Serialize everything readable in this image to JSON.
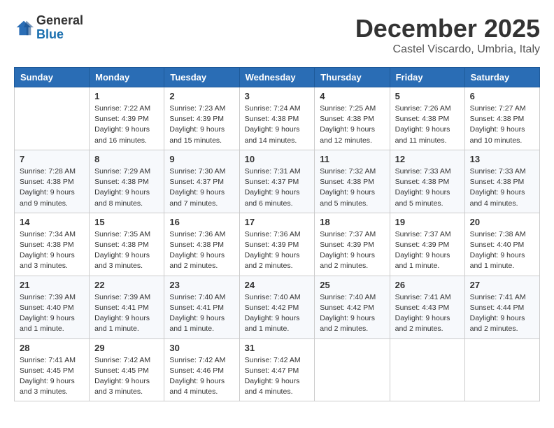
{
  "logo": {
    "general": "General",
    "blue": "Blue"
  },
  "header": {
    "month": "December 2025",
    "location": "Castel Viscardo, Umbria, Italy"
  },
  "weekdays": [
    "Sunday",
    "Monday",
    "Tuesday",
    "Wednesday",
    "Thursday",
    "Friday",
    "Saturday"
  ],
  "weeks": [
    [
      {
        "day": "",
        "text": ""
      },
      {
        "day": "1",
        "text": "Sunrise: 7:22 AM\nSunset: 4:39 PM\nDaylight: 9 hours\nand 16 minutes."
      },
      {
        "day": "2",
        "text": "Sunrise: 7:23 AM\nSunset: 4:39 PM\nDaylight: 9 hours\nand 15 minutes."
      },
      {
        "day": "3",
        "text": "Sunrise: 7:24 AM\nSunset: 4:38 PM\nDaylight: 9 hours\nand 14 minutes."
      },
      {
        "day": "4",
        "text": "Sunrise: 7:25 AM\nSunset: 4:38 PM\nDaylight: 9 hours\nand 12 minutes."
      },
      {
        "day": "5",
        "text": "Sunrise: 7:26 AM\nSunset: 4:38 PM\nDaylight: 9 hours\nand 11 minutes."
      },
      {
        "day": "6",
        "text": "Sunrise: 7:27 AM\nSunset: 4:38 PM\nDaylight: 9 hours\nand 10 minutes."
      }
    ],
    [
      {
        "day": "7",
        "text": "Sunrise: 7:28 AM\nSunset: 4:38 PM\nDaylight: 9 hours\nand 9 minutes."
      },
      {
        "day": "8",
        "text": "Sunrise: 7:29 AM\nSunset: 4:38 PM\nDaylight: 9 hours\nand 8 minutes."
      },
      {
        "day": "9",
        "text": "Sunrise: 7:30 AM\nSunset: 4:37 PM\nDaylight: 9 hours\nand 7 minutes."
      },
      {
        "day": "10",
        "text": "Sunrise: 7:31 AM\nSunset: 4:37 PM\nDaylight: 9 hours\nand 6 minutes."
      },
      {
        "day": "11",
        "text": "Sunrise: 7:32 AM\nSunset: 4:38 PM\nDaylight: 9 hours\nand 5 minutes."
      },
      {
        "day": "12",
        "text": "Sunrise: 7:33 AM\nSunset: 4:38 PM\nDaylight: 9 hours\nand 5 minutes."
      },
      {
        "day": "13",
        "text": "Sunrise: 7:33 AM\nSunset: 4:38 PM\nDaylight: 9 hours\nand 4 minutes."
      }
    ],
    [
      {
        "day": "14",
        "text": "Sunrise: 7:34 AM\nSunset: 4:38 PM\nDaylight: 9 hours\nand 3 minutes."
      },
      {
        "day": "15",
        "text": "Sunrise: 7:35 AM\nSunset: 4:38 PM\nDaylight: 9 hours\nand 3 minutes."
      },
      {
        "day": "16",
        "text": "Sunrise: 7:36 AM\nSunset: 4:38 PM\nDaylight: 9 hours\nand 2 minutes."
      },
      {
        "day": "17",
        "text": "Sunrise: 7:36 AM\nSunset: 4:39 PM\nDaylight: 9 hours\nand 2 minutes."
      },
      {
        "day": "18",
        "text": "Sunrise: 7:37 AM\nSunset: 4:39 PM\nDaylight: 9 hours\nand 2 minutes."
      },
      {
        "day": "19",
        "text": "Sunrise: 7:37 AM\nSunset: 4:39 PM\nDaylight: 9 hours\nand 1 minute."
      },
      {
        "day": "20",
        "text": "Sunrise: 7:38 AM\nSunset: 4:40 PM\nDaylight: 9 hours\nand 1 minute."
      }
    ],
    [
      {
        "day": "21",
        "text": "Sunrise: 7:39 AM\nSunset: 4:40 PM\nDaylight: 9 hours\nand 1 minute."
      },
      {
        "day": "22",
        "text": "Sunrise: 7:39 AM\nSunset: 4:41 PM\nDaylight: 9 hours\nand 1 minute."
      },
      {
        "day": "23",
        "text": "Sunrise: 7:40 AM\nSunset: 4:41 PM\nDaylight: 9 hours\nand 1 minute."
      },
      {
        "day": "24",
        "text": "Sunrise: 7:40 AM\nSunset: 4:42 PM\nDaylight: 9 hours\nand 1 minute."
      },
      {
        "day": "25",
        "text": "Sunrise: 7:40 AM\nSunset: 4:42 PM\nDaylight: 9 hours\nand 2 minutes."
      },
      {
        "day": "26",
        "text": "Sunrise: 7:41 AM\nSunset: 4:43 PM\nDaylight: 9 hours\nand 2 minutes."
      },
      {
        "day": "27",
        "text": "Sunrise: 7:41 AM\nSunset: 4:44 PM\nDaylight: 9 hours\nand 2 minutes."
      }
    ],
    [
      {
        "day": "28",
        "text": "Sunrise: 7:41 AM\nSunset: 4:45 PM\nDaylight: 9 hours\nand 3 minutes."
      },
      {
        "day": "29",
        "text": "Sunrise: 7:42 AM\nSunset: 4:45 PM\nDaylight: 9 hours\nand 3 minutes."
      },
      {
        "day": "30",
        "text": "Sunrise: 7:42 AM\nSunset: 4:46 PM\nDaylight: 9 hours\nand 4 minutes."
      },
      {
        "day": "31",
        "text": "Sunrise: 7:42 AM\nSunset: 4:47 PM\nDaylight: 9 hours\nand 4 minutes."
      },
      {
        "day": "",
        "text": ""
      },
      {
        "day": "",
        "text": ""
      },
      {
        "day": "",
        "text": ""
      }
    ]
  ]
}
